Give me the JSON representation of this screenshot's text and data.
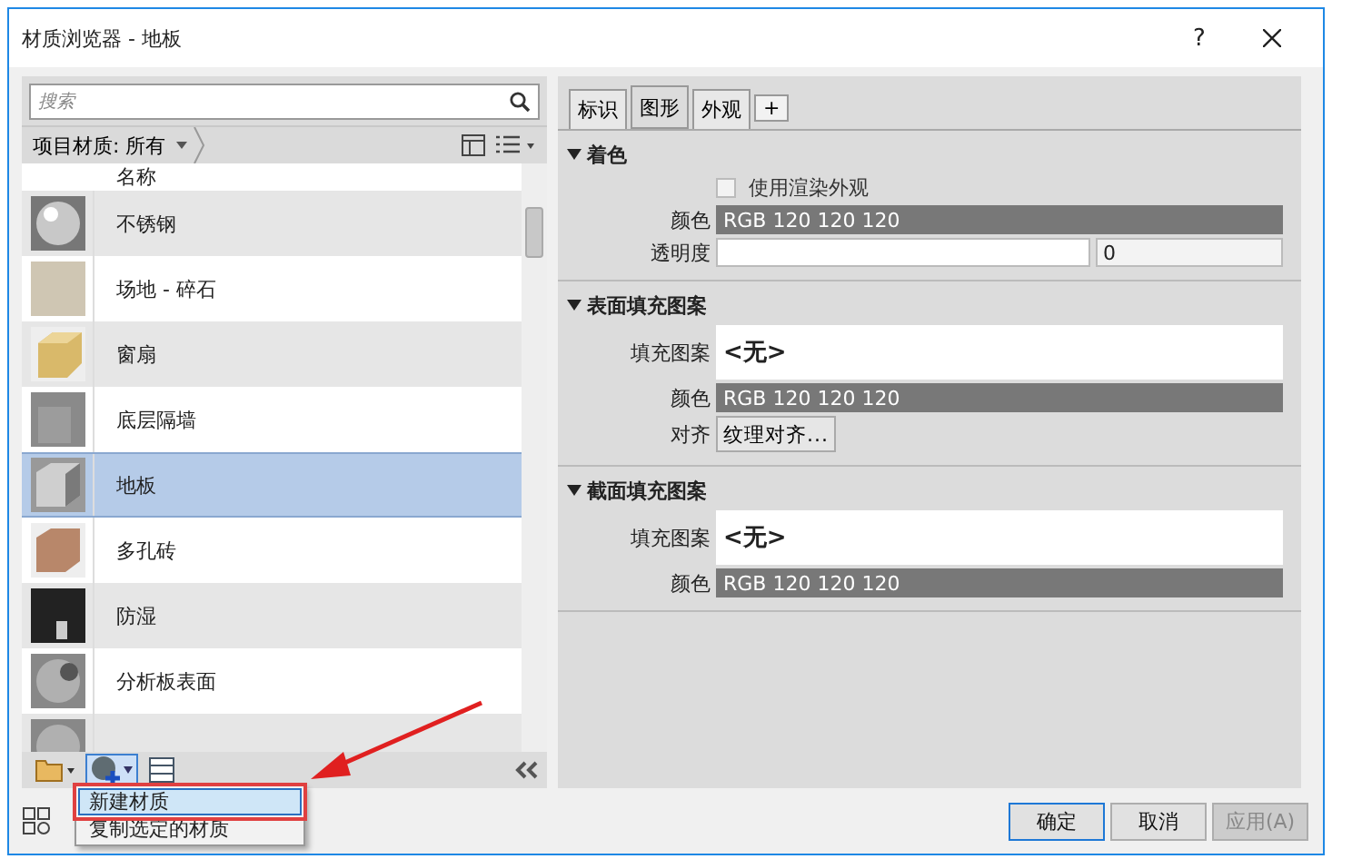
{
  "window": {
    "title": "材质浏览器 - 地板",
    "help": "?"
  },
  "library": {
    "search_placeholder": "搜索",
    "filter": "项目材质: 所有",
    "column": "名称",
    "materials": [
      {
        "name": "不锈钢",
        "selected": false,
        "kind": "sphere"
      },
      {
        "name": "场地 - 碎石",
        "selected": false,
        "kind": "gravel"
      },
      {
        "name": "窗扇",
        "selected": false,
        "kind": "wood"
      },
      {
        "name": "底层隔墙",
        "selected": false,
        "kind": "concrete"
      },
      {
        "name": "地板",
        "selected": true,
        "kind": "stone"
      },
      {
        "name": "多孔砖",
        "selected": false,
        "kind": "brick"
      },
      {
        "name": "防湿",
        "selected": false,
        "kind": "dark"
      },
      {
        "name": "分析板表面",
        "selected": false,
        "kind": "sphere-hole"
      }
    ]
  },
  "tabs": [
    {
      "label": "标识",
      "selected": false
    },
    {
      "label": "图形",
      "selected": true
    },
    {
      "label": "外观",
      "selected": false
    },
    {
      "label": "+",
      "selected": false
    }
  ],
  "sections": [
    {
      "title": "着色",
      "expanded": true,
      "rows": [
        {
          "kind": "checkbox",
          "label": "使用渲染外观",
          "checked": false
        },
        {
          "kind": "color",
          "label": "颜色",
          "value": "RGB 120 120 120"
        },
        {
          "kind": "transparency",
          "label": "透明度",
          "value": "0",
          "level": 0
        }
      ]
    },
    {
      "title": "表面填充图案",
      "expanded": true,
      "rows": [
        {
          "kind": "pattern",
          "label": "填充图案",
          "value": "<无>"
        },
        {
          "kind": "color",
          "label": "颜色",
          "value": "RGB 120 120 120"
        },
        {
          "kind": "button",
          "label": "对齐",
          "value": "纹理对齐..."
        }
      ]
    },
    {
      "title": "截面填充图案",
      "expanded": true,
      "rows": [
        {
          "kind": "pattern",
          "label": "填充图案",
          "value": "<无>"
        },
        {
          "kind": "color",
          "label": "颜色",
          "value": "RGB 120 120 120"
        }
      ]
    }
  ],
  "popup_menu": [
    {
      "label": "新建材质",
      "selected": true
    },
    {
      "label": "复制选定的材质",
      "selected": false
    }
  ],
  "buttons": [
    {
      "label": "确定",
      "default": true,
      "disabled": false
    },
    {
      "label": "取消",
      "default": false,
      "disabled": false
    },
    {
      "label": "应用(A)",
      "default": false,
      "disabled": true
    }
  ]
}
